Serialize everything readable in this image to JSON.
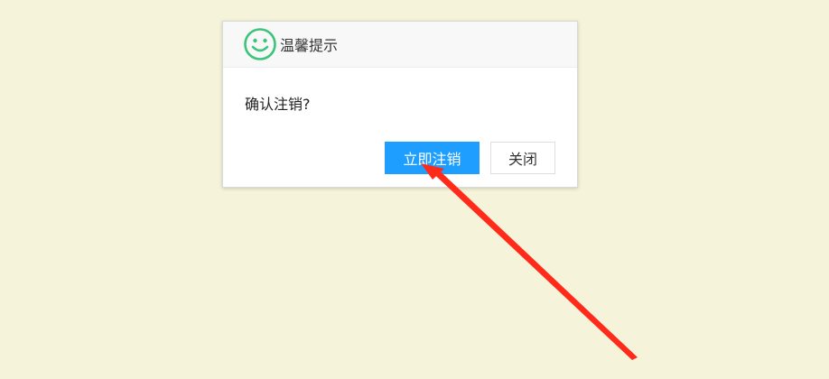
{
  "dialog": {
    "title": "温馨提示",
    "icon": "smile-icon",
    "message": "确认注销?",
    "confirm_label": "立即注销",
    "close_label": "关闭"
  },
  "colors": {
    "background": "#f5f4da",
    "primary": "#1e9fff",
    "smile": "#3cc47c",
    "annotation_arrow": "#ff2a1a"
  }
}
